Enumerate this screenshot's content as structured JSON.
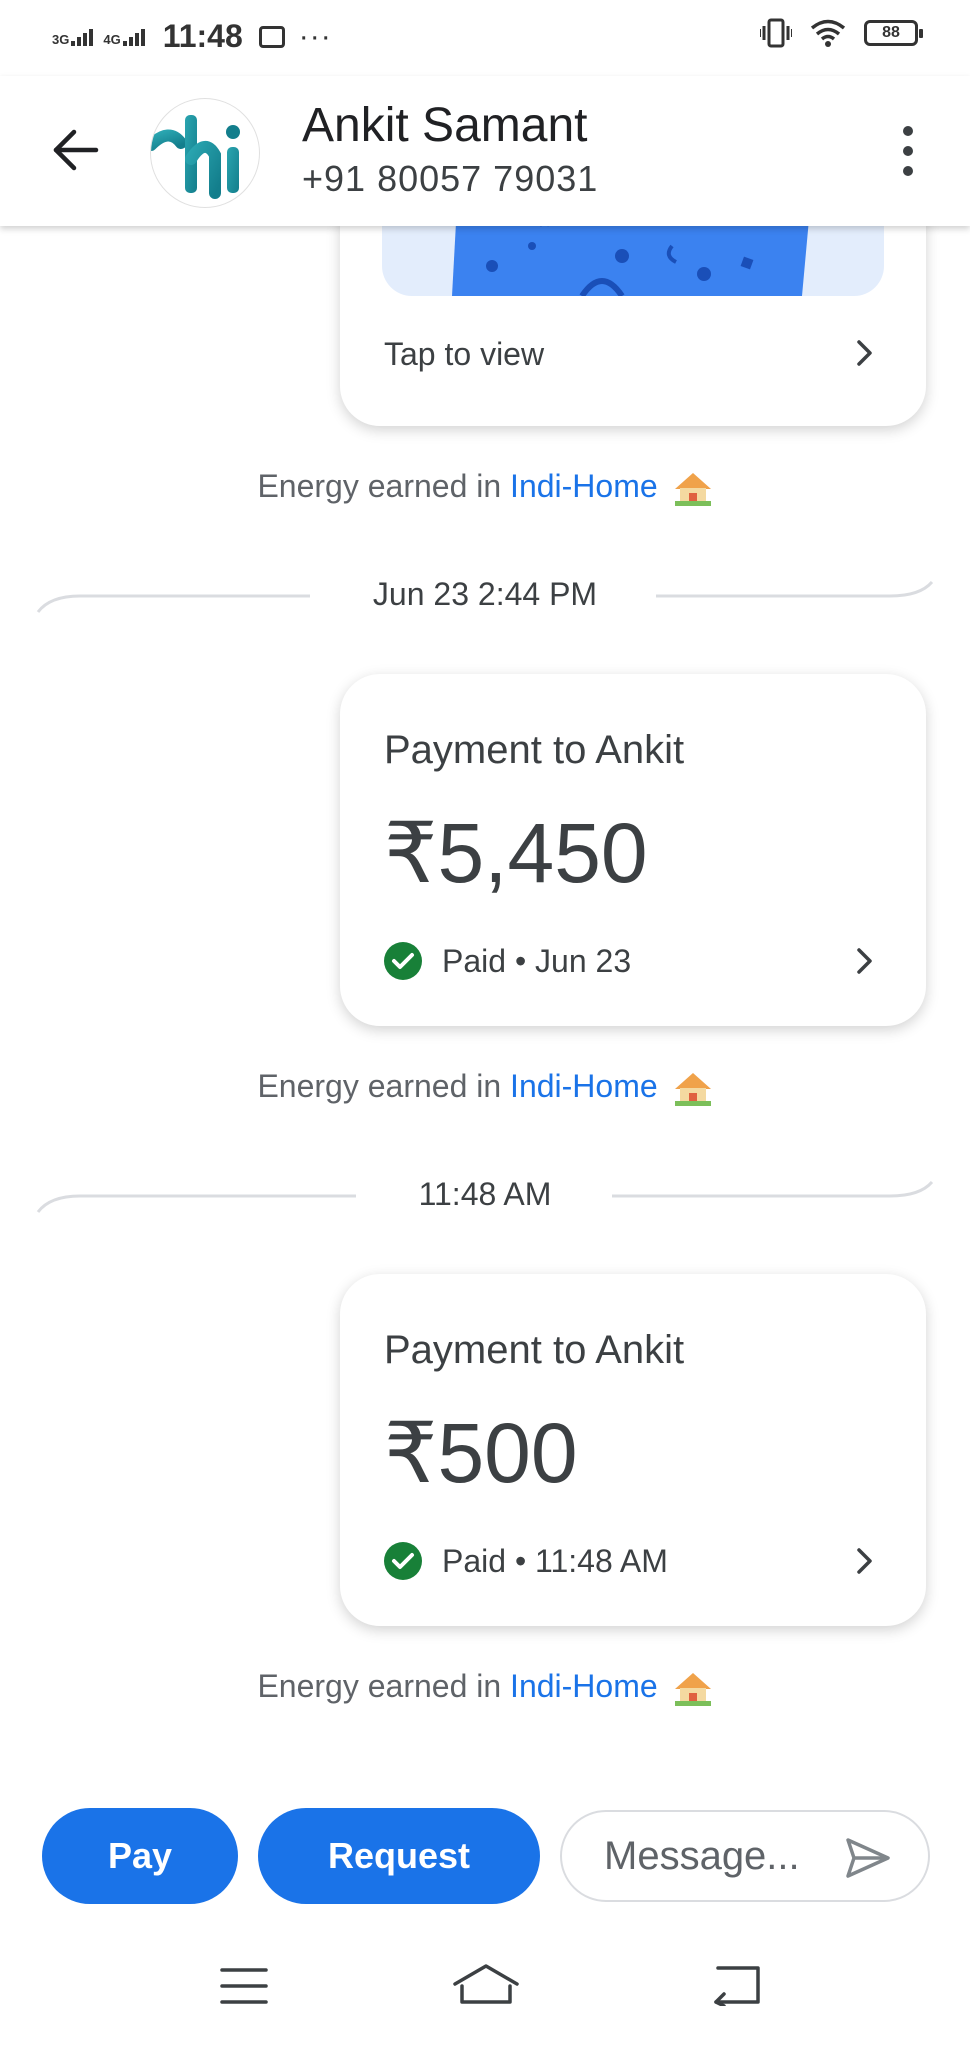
{
  "status_bar": {
    "network1": "3G",
    "network2": "4G",
    "time": "11:48",
    "more": "···",
    "battery": "88"
  },
  "header": {
    "contact_name": "Ankit Samant",
    "contact_phone": "+91 80057 79031",
    "avatar_text": "hi"
  },
  "messages": [
    {
      "type": "image_card",
      "action_label": "Tap to view",
      "energy": {
        "prefix": "Energy earned in ",
        "link": "Indi-Home"
      }
    },
    {
      "type": "divider",
      "label": "Jun 23 2:44 PM"
    },
    {
      "type": "payment",
      "title": "Payment to Ankit",
      "amount": "₹5,450",
      "status": "Paid • Jun 23",
      "energy": {
        "prefix": "Energy earned in ",
        "link": "Indi-Home"
      }
    },
    {
      "type": "divider",
      "label": "11:48 AM"
    },
    {
      "type": "payment",
      "title": "Payment to Ankit",
      "amount": "₹500",
      "status": "Paid • 11:48 AM",
      "energy": {
        "prefix": "Energy earned in ",
        "link": "Indi-Home"
      }
    }
  ],
  "actions": {
    "pay_label": "Pay",
    "request_label": "Request",
    "message_placeholder": "Message..."
  },
  "colors": {
    "accent": "#1a73e8",
    "paid_green": "#188038",
    "text": "#3c4043"
  }
}
